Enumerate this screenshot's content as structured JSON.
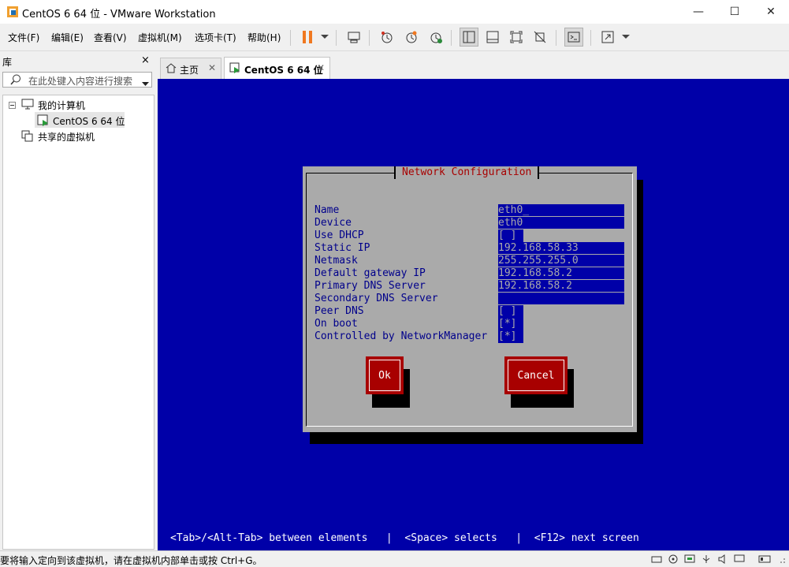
{
  "window": {
    "title": "CentOS 6 64 位 - VMware Workstation",
    "minimize": "—",
    "maximize": "☐",
    "close": "✕"
  },
  "menu": {
    "file": "文件(F)",
    "edit": "编辑(E)",
    "view": "查看(V)",
    "vm": "虚拟机(M)",
    "tabs": "选项卡(T)",
    "help": "帮助(H)"
  },
  "library": {
    "title": "库",
    "close": "×",
    "search_placeholder": "在此处键入内容进行搜索",
    "tree": {
      "my_computer": "我的计算机",
      "vm_item": "CentOS 6 64 位",
      "shared": "共享的虚拟机"
    }
  },
  "tabs": [
    {
      "label": "主页"
    },
    {
      "label": "CentOS 6 64 位"
    }
  ],
  "dialog": {
    "title": "Network Configuration",
    "fields": [
      {
        "label": "Name",
        "value": "eth0_"
      },
      {
        "label": "Device",
        "value": "eth0"
      },
      {
        "label": "Use DHCP",
        "value": "[ ]"
      },
      {
        "label": "Static IP",
        "value": "192.168.58.33"
      },
      {
        "label": "Netmask",
        "value": "255.255.255.0"
      },
      {
        "label": "Default gateway IP",
        "value": "192.168.58.2"
      },
      {
        "label": "Primary DNS Server",
        "value": "192.168.58.2"
      },
      {
        "label": "Secondary DNS Server",
        "value": ""
      },
      {
        "label": "Peer DNS",
        "value": "[ ]"
      },
      {
        "label": "On boot",
        "value": "[*]"
      },
      {
        "label": "Controlled by NetworkManager",
        "value": "[*]"
      }
    ],
    "ok": "Ok",
    "cancel": "Cancel"
  },
  "hint": "<Tab>/<Alt-Tab> between elements   |  <Space> selects   |  <F12> next screen",
  "status": "要将输入定向到该虚拟机，请在虚拟机内部单击或按 Ctrl+G。",
  "colors": {
    "console_bg": "#0000a8",
    "dialog_bg": "#aaaaaa",
    "title_red": "#a80000",
    "button_red": "#a80000",
    "pause_orange": "#f07820"
  }
}
